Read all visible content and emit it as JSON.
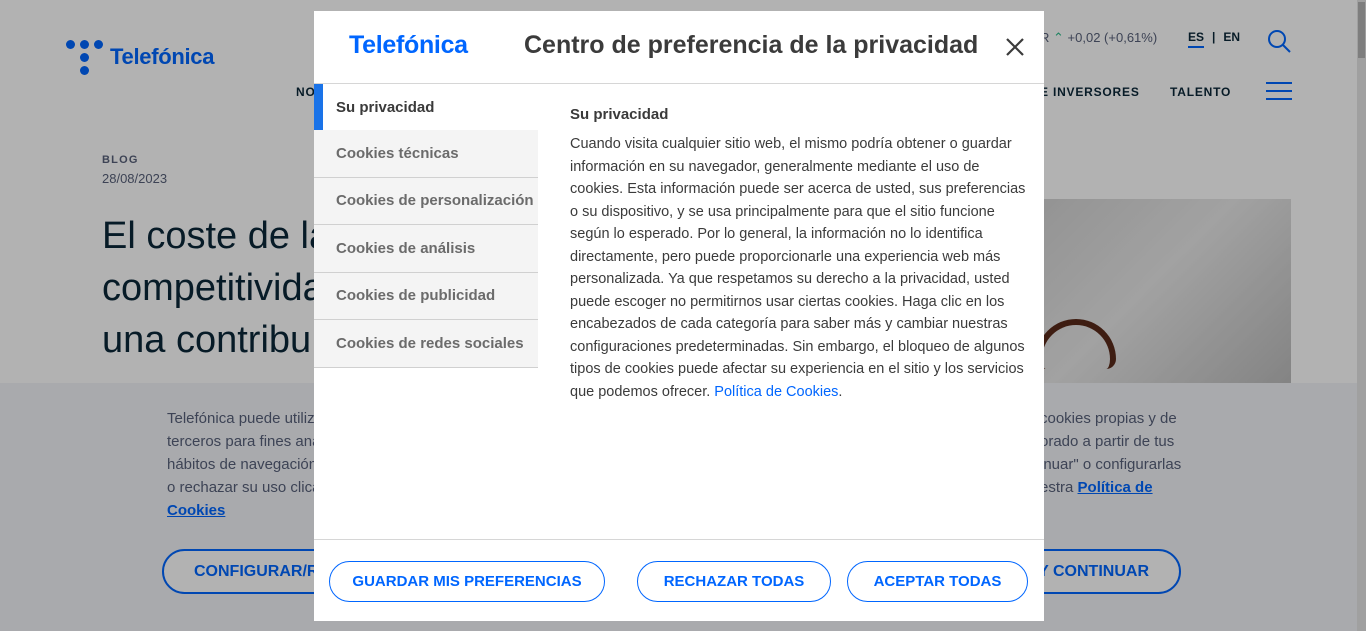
{
  "header": {
    "logo_text": "Telefónica",
    "stock_prefix": "R",
    "stock_change": "+0,02 (+0,61%)",
    "lang_es": "ES",
    "lang_sep": "|",
    "lang_en": "EN",
    "nav_partial_left": "NO",
    "nav_investors": "E INVERSORES",
    "nav_talent": "TALENTO"
  },
  "article": {
    "tag": "BLOG",
    "date": "28/08/2023",
    "title_line1": "El coste de la",
    "title_line2": "competitivida",
    "title_line3": "una contribu"
  },
  "banner": {
    "text_left_1": "Telefónica puede utiliz",
    "text_left_2": "terceros para fines ana",
    "text_left_3": "hábitos de navegación",
    "text_left_4": "o rechazar su uso clica",
    "text_right_1": "cookies propias y de",
    "text_right_2": "orado a partir de tus",
    "text_right_3": "inuar\" o configurarlas",
    "text_right_4": "estra",
    "policy_link_part1": "Política de",
    "policy_link_part2": "Cookies",
    "configure_button": "CONFIGURAR/RE",
    "continue_button": "Y CONTINUAR"
  },
  "modal": {
    "logo_text": "Telefónica",
    "title": "Centro de preferencia de la privacidad",
    "tabs": [
      "Su privacidad",
      "Cookies técnicas",
      "Cookies de personalización",
      "Cookies de análisis",
      "Cookies de publicidad",
      "Cookies de redes sociales"
    ],
    "panel_title": "Su privacidad",
    "panel_text": "Cuando visita cualquier sitio web, el mismo podría obtener o guardar información en su navegador, generalmente mediante el uso de cookies. Esta información puede ser acerca de usted, sus preferencias o su dispositivo, y se usa principalmente para que el sitio funcione según lo esperado. Por lo general, la información no lo identifica directamente, pero puede proporcionarle una experiencia web más personalizada. Ya que respetamos su derecho a la privacidad, usted puede escoger no permitirnos usar ciertas cookies. Haga clic en los encabezados de cada categoría para saber más y cambiar nuestras configuraciones predeterminadas. Sin embargo, el bloqueo de algunos tipos de cookies puede afectar su experiencia en el sitio y los servicios que podemos ofrecer.",
    "policy_link": "Política de Cookies",
    "policy_period": ".",
    "buttons": {
      "save": "GUARDAR MIS PREFERENCIAS",
      "reject": "RECHAZAR TODAS",
      "accept": "ACEPTAR TODAS"
    }
  },
  "colors": {
    "brand_blue": "#0066ff",
    "active_tab_bar": "#1a73e8",
    "text_dark": "#3b3b3b"
  }
}
